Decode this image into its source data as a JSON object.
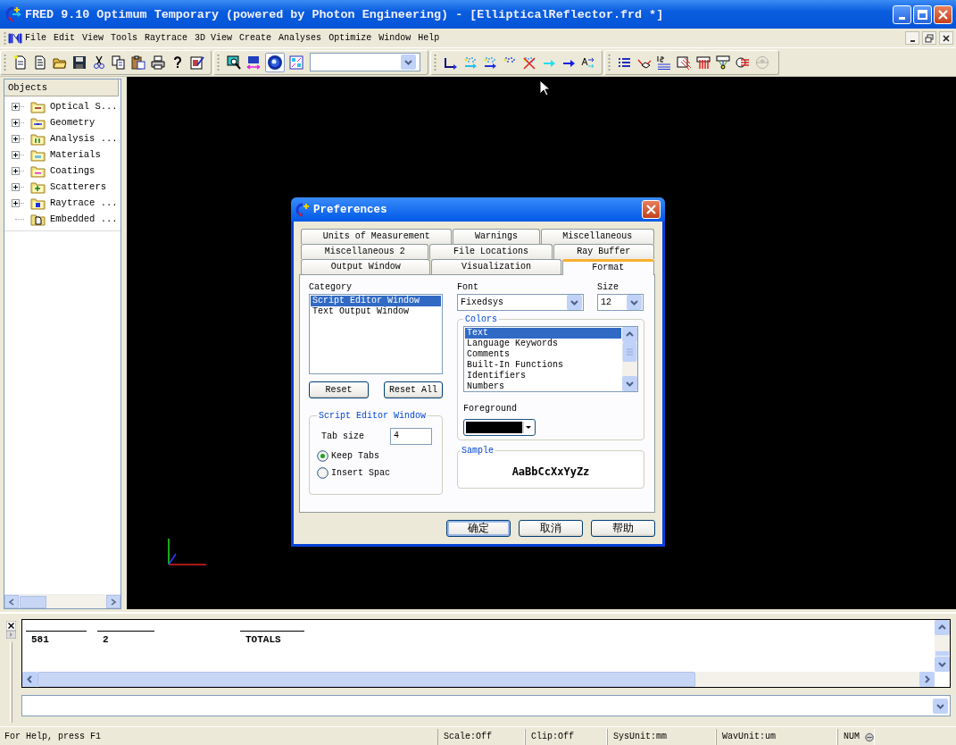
{
  "window": {
    "title": "FRED 9.10 Optimum Temporary (powered by Photon Engineering) - [EllipticalReflector.frd *]"
  },
  "menu": [
    "File",
    "Edit",
    "View",
    "Tools",
    "Raytrace",
    "3D View",
    "Create",
    "Analyses",
    "Optimize",
    "Window",
    "Help"
  ],
  "objects_panel": {
    "header": "Objects",
    "items": [
      {
        "label": "Optical S...",
        "kind": "group",
        "expanded": false
      },
      {
        "label": "Geometry",
        "kind": "group",
        "expanded": false
      },
      {
        "label": "Analysis ...",
        "kind": "group",
        "expanded": false
      },
      {
        "label": "Materials",
        "kind": "group",
        "expanded": false
      },
      {
        "label": "Coatings",
        "kind": "group",
        "expanded": false
      },
      {
        "label": "Scatterers",
        "kind": "group",
        "expanded": false
      },
      {
        "label": "Raytrace ...",
        "kind": "group",
        "expanded": false
      },
      {
        "label": "Embedded ...",
        "kind": "leaf"
      }
    ]
  },
  "dialog": {
    "title": "Preferences",
    "tab_rows": [
      [
        {
          "label": "Units of Measurement",
          "selected": false
        },
        {
          "label": "Warnings",
          "selected": false
        },
        {
          "label": "Miscellaneous",
          "selected": false
        }
      ],
      [
        {
          "label": "Miscellaneous 2",
          "selected": false
        },
        {
          "label": "File Locations",
          "selected": false
        },
        {
          "label": "Ray Buffer",
          "selected": false
        }
      ],
      [
        {
          "label": "Output Window",
          "selected": false
        },
        {
          "label": "Visualization",
          "selected": false
        },
        {
          "label": "Format",
          "selected": true
        }
      ]
    ],
    "category": {
      "label": "Category",
      "items": [
        {
          "label": "Script Editor Window",
          "selected": true
        },
        {
          "label": "Text Output Window",
          "selected": false
        }
      ]
    },
    "reset_buttons": [
      "Reset",
      "Reset All"
    ],
    "editor_group": {
      "title": "Script Editor Window",
      "tab_size_label": "Tab size",
      "tab_size": "4",
      "options": [
        {
          "label": "Keep Tabs",
          "selected": true
        },
        {
          "label": "Insert Spac",
          "selected": false
        }
      ]
    },
    "font": {
      "label": "Font",
      "value": "Fixedsys"
    },
    "size": {
      "label": "Size",
      "value": "12"
    },
    "colors": {
      "title": "Colors",
      "items": [
        {
          "label": "Text",
          "selected": true
        },
        {
          "label": "Language Keywords",
          "selected": false
        },
        {
          "label": "Comments",
          "selected": false
        },
        {
          "label": "Built-In Functions",
          "selected": false
        },
        {
          "label": "Identifiers",
          "selected": false
        },
        {
          "label": "Numbers",
          "selected": false
        }
      ],
      "foreground_label": "Foreground"
    },
    "sample": {
      "title": "Sample",
      "text": "AaBbCcXxYyZz"
    },
    "buttons": [
      "确定",
      "取消",
      "帮助"
    ]
  },
  "output": {
    "columns": [
      "581",
      "2",
      "TOTALS"
    ]
  },
  "status_bar": {
    "help": "For Help, press F1",
    "fields": [
      "Scale:Off",
      "Clip:Off",
      "SysUnit:mm",
      "WavUnit:um",
      "NUM"
    ]
  }
}
